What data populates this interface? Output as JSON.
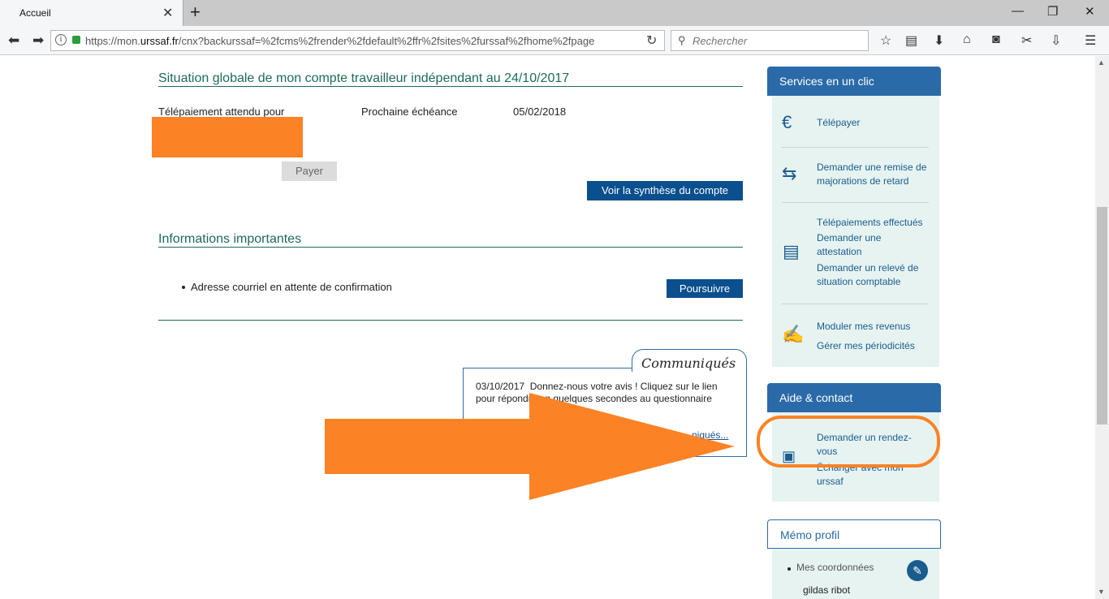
{
  "browser": {
    "tab_title": "Accueil",
    "url_prefix": "https://mon.",
    "url_domain": "urssaf.fr",
    "url_rest": "/cnx?backurssaf=%2fcms%2frender%2fdefault%2ffr%2fsites%2furssaf%2fhome%2fpage",
    "search_placeholder": "Rechercher"
  },
  "account": {
    "title": "Situation globale de mon compte travailleur indépendant au 24/10/2017",
    "payment_label": "Télépaiement attendu pour",
    "next_due_label": "Prochaine échéance",
    "next_due_date": "05/02/2018",
    "pay_button": "Payer",
    "summary_button": "Voir la synthèse du compte"
  },
  "info": {
    "title": "Informations importantes",
    "items": [
      "Adresse courriel en attente de confirmation"
    ],
    "continue_button": "Poursuivre"
  },
  "communiques": {
    "title": "Communiqués",
    "date": "03/10/2017",
    "text": "Donnez-nous votre avis ! Cliquez sur le lien pour répondre en quelques secondes au questionnaire",
    "link": "…niqués..."
  },
  "services": {
    "title": "Services en un clic",
    "items": [
      {
        "icon": "euro-icon",
        "links": [
          "Télépayer"
        ]
      },
      {
        "icon": "exchange-icon",
        "links": [
          "Demander une remise de majorations de retard"
        ]
      },
      {
        "icon": "document-icon",
        "links": [
          "Télépaiements effectués",
          "Demander une attestation",
          "Demander un relevé de situation comptable"
        ]
      },
      {
        "icon": "edit-hand-icon",
        "links": [
          "Moduler mes revenus",
          "Gérer mes périodicités"
        ]
      }
    ]
  },
  "help": {
    "title": "Aide & contact",
    "links": [
      "Demander un rendez-vous",
      "Échanger avec mon urssaf"
    ]
  },
  "memo": {
    "title": "Mémo profil",
    "coords_label": "Mes coordonnées",
    "user_name": "gildas ribot"
  },
  "colors": {
    "accent_blue": "#2a6aa8",
    "button_blue": "#0a4f8e",
    "title_green": "#1e6a5a",
    "annotation_orange": "#fb8225"
  }
}
